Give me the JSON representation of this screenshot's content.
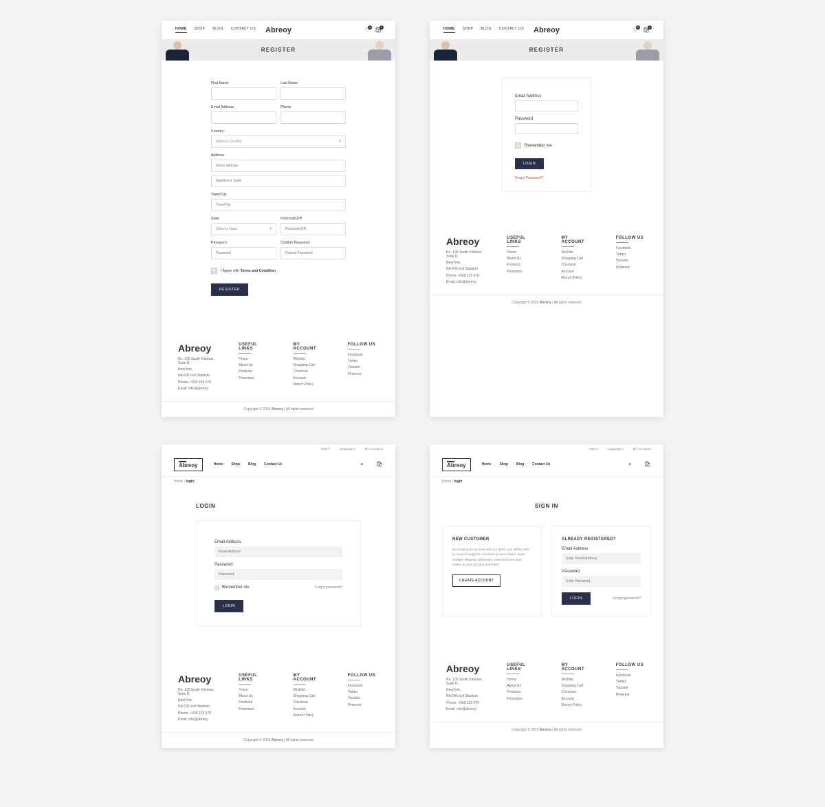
{
  "brand": "Abreoy",
  "nav": {
    "home": "HOME",
    "shop": "SHOP",
    "blog": "BLOG",
    "contact": "CONTACT US"
  },
  "nav2": {
    "home": "Home",
    "shop": "Shop",
    "blog": "Blog",
    "contact": "Contact Us"
  },
  "header_badges": {
    "wishlist": "0",
    "cart": "0"
  },
  "topstrip": {
    "currency": "USD",
    "language": "Language",
    "account": "My Account"
  },
  "banners": {
    "register": "REGISTER",
    "signin": "SIGN IN",
    "login": "LOGIN"
  },
  "breadcrumb": {
    "home": "Home",
    "sep": "/",
    "login": "login"
  },
  "register_form": {
    "first_name": "First Name",
    "last_name": "Last Name",
    "email": "Email Address",
    "phone": "Phone",
    "country": "Country",
    "country_ph": "Select a Country",
    "address": "Address",
    "street_ph": "Street address",
    "apt_ph": "Apartment, Suite",
    "town": "Town/City",
    "town_ph": "Town/City",
    "state": "State",
    "state_ph": "Select a State",
    "postcode": "Postcode/ZIP",
    "postcode_ph": "Postcode/ZIP",
    "password": "Password",
    "password_ph": "Password",
    "confirm": "Confirm Password",
    "confirm_ph": "Repeat Password",
    "agree_prefix": "I Agree with",
    "agree_link": "Terms and Condition",
    "submit": "REGISTER"
  },
  "login_small": {
    "email": "Email Address",
    "password": "Password",
    "remember": "Remember me",
    "submit": "LOGIN",
    "forgot": "Forgot Password?"
  },
  "login_wide": {
    "email": "Email Address",
    "email_ph": "Email Address",
    "password": "Password",
    "password_ph": "Password",
    "remember": "Remember me",
    "submit": "LOGIN",
    "forgot": "Forgot password?"
  },
  "signin": {
    "new_title": "NEW CUSTOMER",
    "new_body": "By creating an account with our store, you will be able to move through the checkout process faster, store multiple shipping addresses, view and track your orders in your account and more.",
    "create_btn": "CREATE ACCOUNT",
    "reg_title": "ALREADY REGISTERED?",
    "email": "Email Address",
    "email_ph": "Enter Email Address",
    "password": "Password",
    "password_ph": "Enter Password",
    "submit": "LOGIN",
    "forgot": "Forgot password?"
  },
  "footer": {
    "addr1": "No. 135 South Kirkman Suite D,",
    "addr2": "NewYork,",
    "addr3": "NA 600 civil Stadium",
    "phone": "Phone: +568 225 670",
    "email": "Email: info@abreoy",
    "cols": {
      "useful": {
        "title": "USEFUL LINKS",
        "items": [
          "Home",
          "About Us",
          "Products",
          "Promotion"
        ]
      },
      "account": {
        "title": "MY ACCOUNT",
        "items": [
          "Wishlist",
          "Shopping Cart",
          "Checkout",
          "Account",
          "Return Policy"
        ]
      },
      "follow": {
        "title": "FOLLOW US",
        "items": [
          "Facebook",
          "Twitter",
          "Youtube",
          "Pinterest"
        ]
      }
    },
    "copyright_pre": "Copyright © 2019 ",
    "copyright_brand": "Abreoy",
    "copyright_post": " | All rights reserved"
  }
}
